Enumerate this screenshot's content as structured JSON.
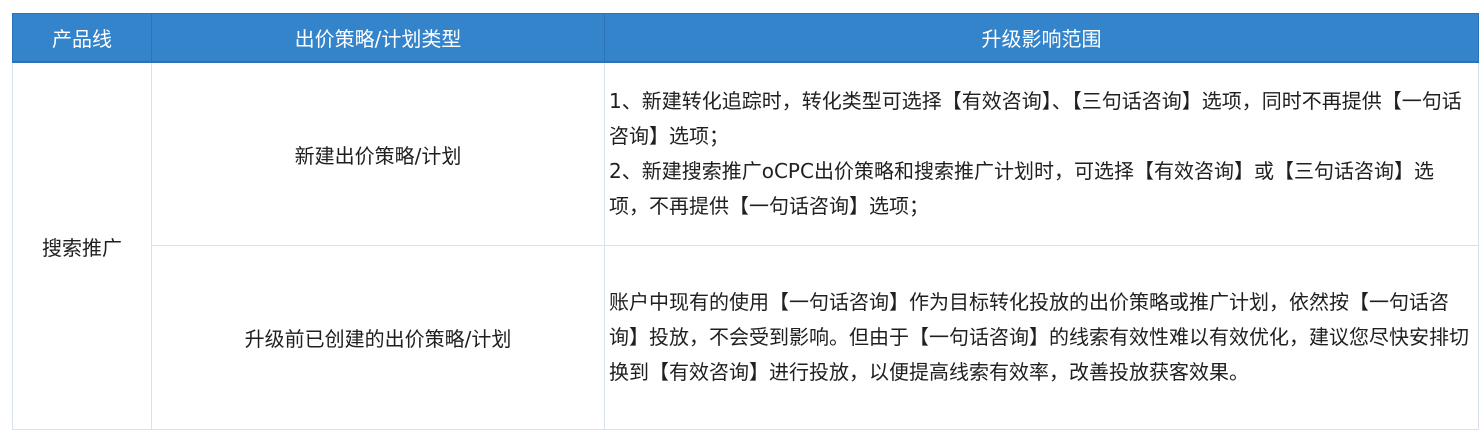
{
  "table": {
    "headers": [
      "产品线",
      "出价策略/计划类型",
      "升级影响范围"
    ],
    "product_line": "搜索推广",
    "rows": [
      {
        "type": "新建出价策略/计划",
        "impact": [
          "1、新建转化追踪时，转化类型可选择【有效咨询】、【三句话咨询】选项，同时不再提供【一句话咨询】选项；",
          "2、新建搜索推广oCPC出价策略和搜索推广计划时，可选择【有效咨询】或【三句话咨询】选项，不再提供【一句话咨询】选项；"
        ]
      },
      {
        "type": "升级前已创建的出价策略/计划",
        "impact": [
          "账户中现有的使用【一句话咨询】作为目标转化投放的出价策略或推广计划，依然按【一句话咨询】投放，不会受到影响。但由于【一句话咨询】的线索有效性难以有效优化，建议您尽快安排切换到【有效咨询】进行投放，以便提高线索有效率，改善投放获客效果。"
        ]
      }
    ]
  },
  "colors": {
    "header_bg": "#3384cb",
    "header_text": "#ffffff",
    "border": "#d9e2ec"
  }
}
